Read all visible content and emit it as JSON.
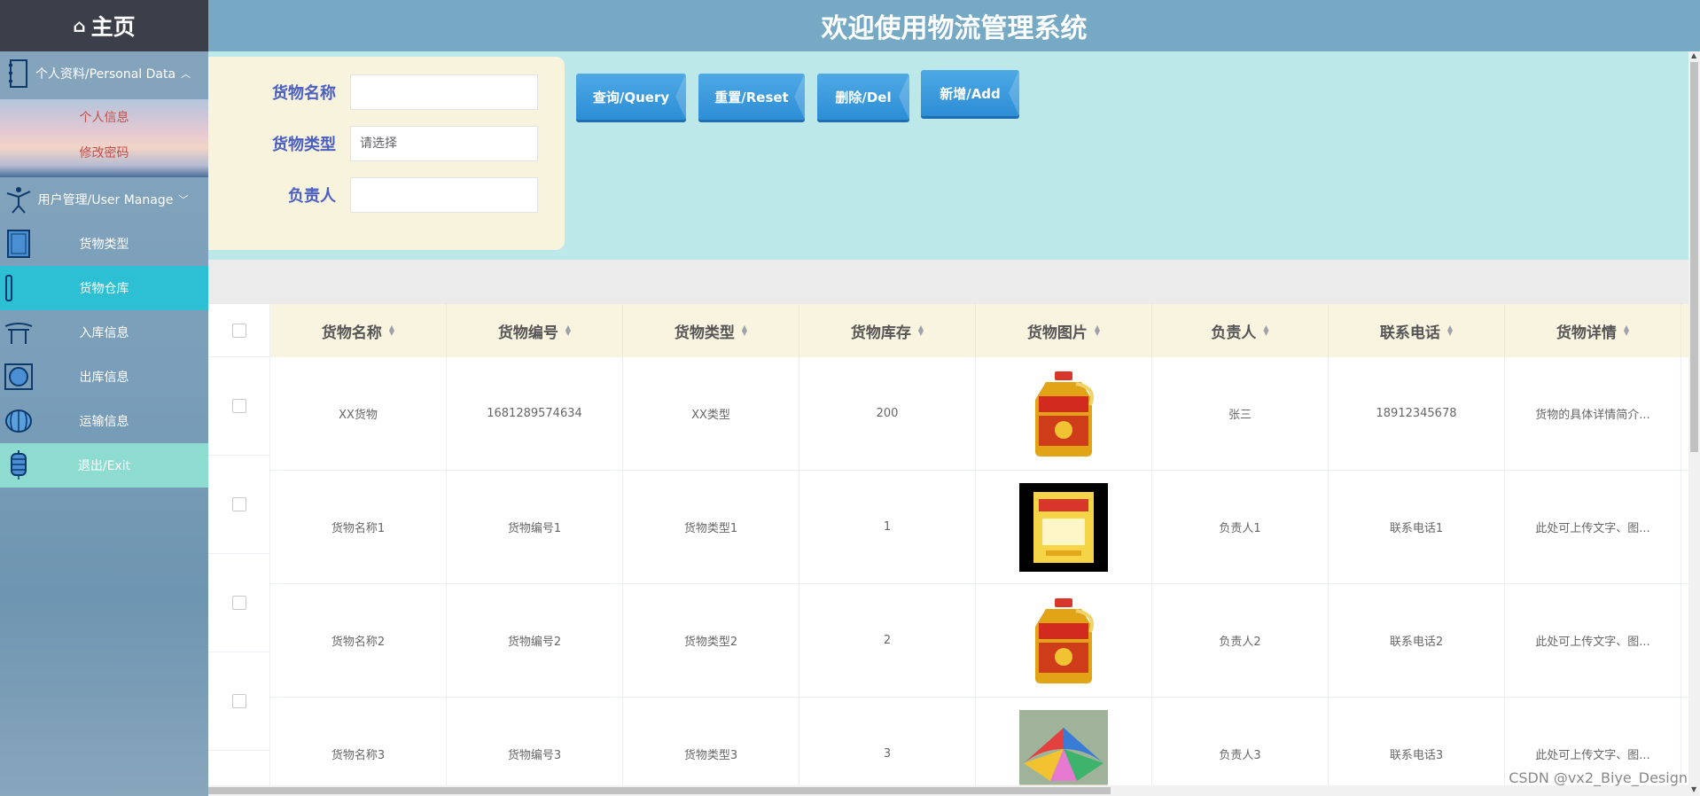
{
  "sidebar": {
    "home_icon": "⌂",
    "home_label": "主页",
    "personal": {
      "label": "个人资料/Personal Data",
      "icon": "notebook-icon",
      "expanded": true,
      "items": [
        {
          "label": "个人信息"
        },
        {
          "label": "修改密码"
        }
      ]
    },
    "user_manage": {
      "label": "用户管理/User Manage",
      "icon": "figure-icon",
      "expanded": false
    },
    "items": [
      {
        "label": "货物类型",
        "icon": "book-icon"
      },
      {
        "label": "货物仓库",
        "icon": "bookmark-icon",
        "active": true
      },
      {
        "label": "入库信息",
        "icon": "gate-icon"
      },
      {
        "label": "出库信息",
        "icon": "plate-icon"
      },
      {
        "label": "运输信息",
        "icon": "lantern-icon"
      },
      {
        "label": "退出/Exit",
        "icon": "hanging-lantern-icon"
      }
    ]
  },
  "header": {
    "title": "欢迎使用物流管理系统"
  },
  "search": {
    "fields": [
      {
        "label": "货物名称",
        "value": "",
        "placeholder": ""
      },
      {
        "label": "货物类型",
        "value": "",
        "placeholder": "请选择"
      },
      {
        "label": "负责人",
        "value": "",
        "placeholder": ""
      }
    ],
    "buttons": {
      "query": "查询/Query",
      "reset": "重置/Reset",
      "delete": "删除/Del",
      "add": "新增/Add"
    }
  },
  "table": {
    "columns": [
      "货物名称",
      "货物编号",
      "货物类型",
      "货物库存",
      "货物图片",
      "负责人",
      "联系电话",
      "货物详情"
    ],
    "rows": [
      [
        "XX货物",
        "1681289574634",
        "XX类型",
        "200",
        "oil",
        "张三",
        "18912345678",
        "货物的具体详情简介..."
      ],
      [
        "货物名称1",
        "货物编号1",
        "货物类型1",
        "1",
        "rice",
        "负责人1",
        "联系电话1",
        "此处可上传文字、图..."
      ],
      [
        "货物名称2",
        "货物编号2",
        "货物类型2",
        "2",
        "oil",
        "负责人2",
        "联系电话2",
        "此处可上传文字、图..."
      ],
      [
        "货物名称3",
        "货物编号3",
        "货物类型3",
        "3",
        "umbrella",
        "负责人3",
        "联系电话3",
        "此处可上传文字、图..."
      ]
    ]
  },
  "watermark": "CSDN @vx2_Biye_Design",
  "colors": {
    "header": "#76a9c4",
    "active": "#2dbfd4",
    "exit": "#8edcd0",
    "label": "#4a5fc1",
    "button": "#2d8ed6"
  }
}
